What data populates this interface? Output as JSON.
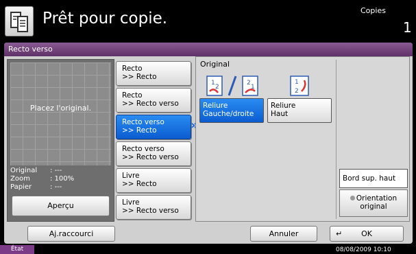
{
  "header": {
    "icon": "document-copy-icon",
    "title": "Prêt pour copie.",
    "copies_label": "Copies",
    "copies_count": "1"
  },
  "section": {
    "title": "Recto verso"
  },
  "preview": {
    "placeholder": "Placez l'original.",
    "info": [
      {
        "label": "Original",
        "value": ": ---"
      },
      {
        "label": "Zoom",
        "value": ": 100%"
      },
      {
        "label": "Papier",
        "value": ": ---"
      }
    ],
    "apercu_label": "Aperçu"
  },
  "modes": [
    {
      "line1": "Recto",
      "line2": ">> Recto"
    },
    {
      "line1": "Recto",
      "line2": ">> Recto verso"
    },
    {
      "line1": "Recto verso",
      "line2": ">> Recto"
    },
    {
      "line1": "Recto verso",
      "line2": ">> Recto verso"
    },
    {
      "line1": "Livre",
      "line2": ">> Recto"
    },
    {
      "line1": "Livre",
      "line2": ">> Recto verso"
    }
  ],
  "original": {
    "label": "Original",
    "reliure_gd": {
      "line1": "Reliure",
      "line2": "Gauche/droite"
    },
    "reliure_haut": {
      "line1": "Reliure",
      "line2": "Haut"
    },
    "bord_sup": "Bord sup. haut",
    "orientation": {
      "line1": "Orientation",
      "line2": "original"
    }
  },
  "bottom": {
    "raccourci": "Aj.raccourci",
    "annuler": "Annuler",
    "ok": "OK"
  },
  "status": {
    "etat": "État",
    "datetime": "08/08/2009   10:10"
  },
  "colors": {
    "accent": "#0b5cd0",
    "section_bar": "#6a3a73",
    "status_tag": "#7b3b86"
  }
}
